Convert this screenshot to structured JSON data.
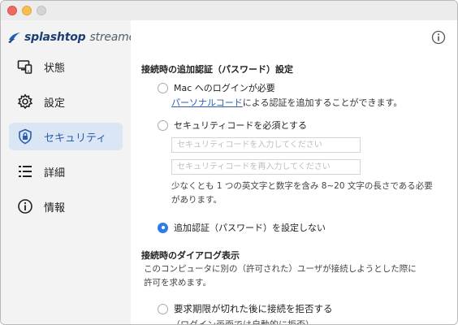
{
  "window": {
    "traffic_lights": [
      "close",
      "minimize",
      "zoom"
    ]
  },
  "logo": {
    "icon": "splashtop-logo-icon",
    "word1": "splashtop",
    "word2": "streamer"
  },
  "sidebar": {
    "items": [
      {
        "label": "状態",
        "icon": "status-monitor-icon",
        "active": false
      },
      {
        "label": "設定",
        "icon": "gear-icon",
        "active": false
      },
      {
        "label": "セキュリティ",
        "icon": "security-shield-icon",
        "active": true
      },
      {
        "label": "詳細",
        "icon": "advanced-list-icon",
        "active": false
      },
      {
        "label": "情報",
        "icon": "info-icon",
        "active": false
      }
    ]
  },
  "main": {
    "info_button_icon": "info-icon",
    "auth_section": {
      "title": "接続時の追加認証（パスワード）設定",
      "option_mac_login": "Mac へのログインが必要",
      "personal_code_link": "パーソナルコード",
      "personal_code_rest": "による認証を追加することができます。",
      "option_security_code": "セキュリティコードを必須とする",
      "code_input_placeholder": "セキュリティコードを入力してください",
      "code_reinput_placeholder": "セキュリティコードを再入力してください",
      "code_requirement_line1": "少なくとも 1 つの英文字と数字を含み 8~20 文字の長さである必要",
      "code_requirement_line2": "があります。",
      "option_no_auth": "追加認証（パスワード）を設定しない",
      "selected": "option_no_auth"
    },
    "dialog_section": {
      "title": "接続時のダイアログ表示",
      "desc_line1": "このコンピュータに別の（許可された）ユーザが接続しようとした際に",
      "desc_line2": "許可を求めます。",
      "option_reject_after_expiry": "要求期限が切れた後に接続を拒否する",
      "option_reject_note_partial": "（ログイン画面では自動的に拒否）"
    }
  },
  "colors": {
    "accent": "#2f7be8",
    "active_nav_bg": "#dbe6f5",
    "link": "#2a5db0",
    "logo_dark": "#1c3f73"
  }
}
